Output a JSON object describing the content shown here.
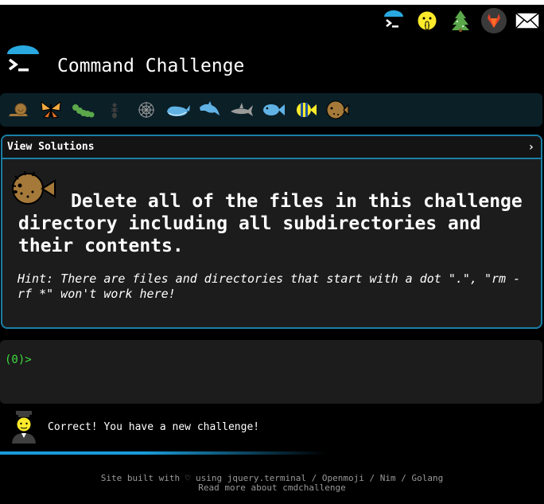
{
  "app": {
    "title": "Command Challenge"
  },
  "top_icons": [
    {
      "name": "terminal-logo-icon"
    },
    {
      "name": "shushing-face-icon"
    },
    {
      "name": "tree-icon"
    },
    {
      "name": "gitlab-icon"
    },
    {
      "name": "envelope-icon"
    }
  ],
  "creatures": [
    "snail",
    "butterfly",
    "caterpillar",
    "ant",
    "spider-web",
    "whale",
    "dolphin",
    "shark",
    "fish",
    "tropical-fish",
    "pufferfish"
  ],
  "panel": {
    "header_label": "View Solutions",
    "chevron": "›",
    "question": "Delete all of the files in this challenge directory including all subdirectories and their contents.",
    "hint": "Hint: There are files and directories that start with a dot \".\", \"rm -rf *\" won't work here!"
  },
  "terminal": {
    "prompt": "(0)>"
  },
  "status": {
    "message": "Correct! You have a new challenge!"
  },
  "footer": {
    "line1": "Site built with ♡ using jquery.terminal / Openmoji / Nim / Golang",
    "line2": "Read more about cmdchallenge"
  },
  "colors": {
    "accent": "#1a7fa6",
    "prompt_green": "#3ddc3d",
    "panel_bg": "#1c1c1c"
  }
}
